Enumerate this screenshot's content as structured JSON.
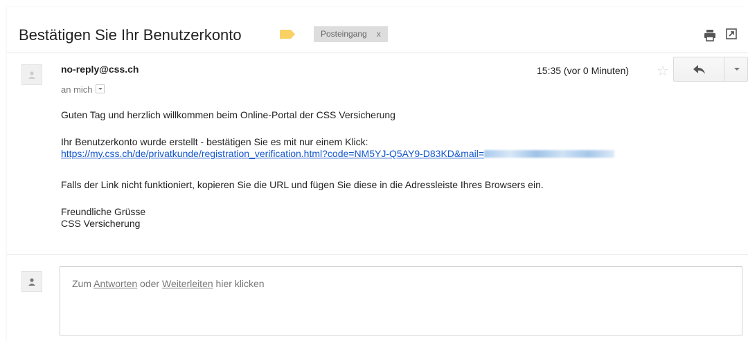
{
  "email": {
    "subject": "Bestätigen Sie Ihr Benutzerkonto",
    "label_chip": "Posteingang",
    "label_chip_remove": "x",
    "sender": "no-reply@css.ch",
    "recipient": "an mich",
    "time": "15:35 (vor 0 Minuten)",
    "greeting": "Guten Tag und herzlich willkommen beim Online-Portal der CSS Versicherung",
    "account_line": "Ihr Benutzerkonto wurde erstellt - bestätigen Sie es mit nur einem Klick:",
    "verify_link": "https://my.css.ch/de/privatkunde/registration_verification.html?code=NM5YJ-Q5AY9-D83KD&mail=",
    "fallback_line": "Falls der Link nicht funktioniert, kopieren Sie die URL und fügen Sie diese in die Adressleiste Ihres Browsers ein.",
    "closing": "Freundliche Grüsse",
    "signature": "CSS Versicherung"
  },
  "reply": {
    "prefix": "Zum ",
    "reply_link": "Antworten",
    "middle": " oder ",
    "forward_link": "Weiterleiten",
    "suffix": " hier klicken"
  },
  "icons": {
    "label_tag_color": "#fad165",
    "star": "star-icon",
    "reply": "reply-arrow-icon",
    "print": "print-icon",
    "popout": "new-window-icon"
  },
  "colors": {
    "link": "#1155cc",
    "muted": "#777777"
  }
}
